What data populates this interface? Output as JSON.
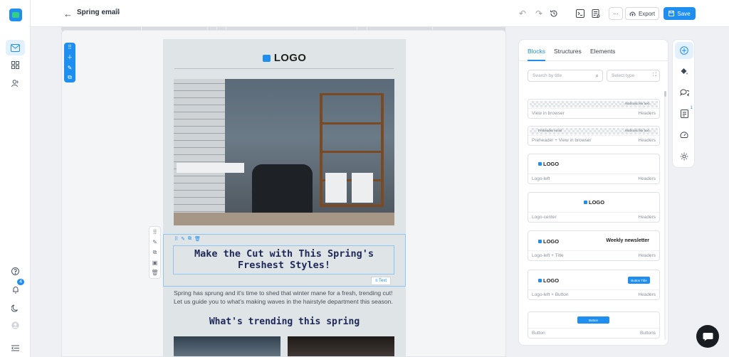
{
  "topbar": {
    "title": "Spring email",
    "export_label": "Export",
    "save_label": "Save",
    "more_label": "···"
  },
  "email": {
    "logo_text": "LOGO",
    "headline": "Make the Cut with This Spring's Freshest Styles!",
    "body": "Spring has sprung and it's time to shed that winter mane for a fresh, trending cut! Let us guide you to what's making waves in the hairstyle department this season.",
    "subheading": "What's trending this spring",
    "text_tag": "≡ Text"
  },
  "panel": {
    "tabs": [
      "Blocks",
      "Structures",
      "Elements"
    ],
    "search_placeholder": "Search by title",
    "select_placeholder": "Select type",
    "cards": [
      {
        "name": "View in browser",
        "category": "Headers",
        "mini_right": "Webmail link text"
      },
      {
        "name": "Preheader + View in browser",
        "category": "Headers",
        "mini_left": "Preheader email",
        "mini_right": "Webmail link text"
      },
      {
        "name": "Logo-left",
        "category": "Headers",
        "logo": "LOGO"
      },
      {
        "name": "Logo-center",
        "category": "Headers",
        "logo": "LOGO"
      },
      {
        "name": "Logo-left + Title",
        "category": "Headers",
        "logo": "LOGO",
        "title": "Weekly newsletter"
      },
      {
        "name": "Logo-left + Button",
        "category": "Headers",
        "logo": "LOGO",
        "button": "Button Title"
      },
      {
        "name": "Button",
        "category": "Buttons",
        "button": "Button"
      }
    ]
  },
  "rail": {
    "notification_count": "4"
  },
  "strip": {
    "badge": "1"
  },
  "colors": {
    "accent": "#1f8ef1",
    "headline": "#1d2858"
  }
}
